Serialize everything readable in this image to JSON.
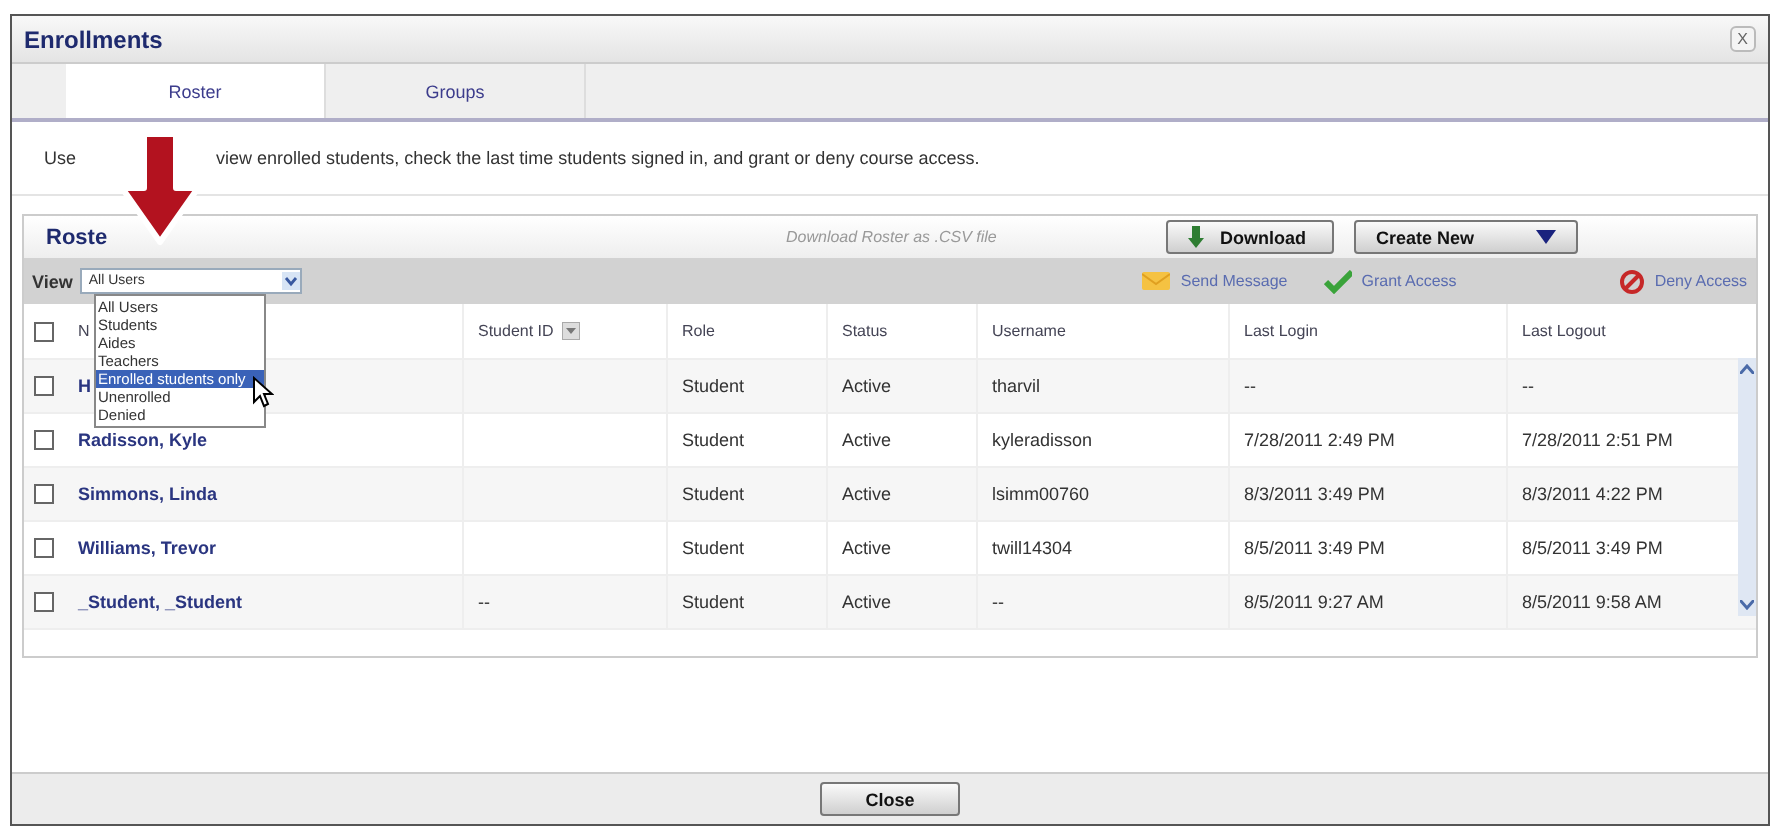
{
  "window": {
    "title": "Enrollments",
    "close": "X"
  },
  "tabs": [
    {
      "label": "Roster",
      "selected": true
    },
    {
      "label": "Groups",
      "selected": false
    }
  ],
  "instructions": [
    "Use",
    "view enrolled students, check the last time students signed in, and grant or deny course access."
  ],
  "panel": {
    "title": "Roste",
    "download_hint": "Download  Roster  as  .CSV file",
    "download_button": "Download",
    "create_button": "Create New"
  },
  "toolbar": {
    "view_label": "View",
    "view_value": "All Users",
    "actions": [
      {
        "label": "Send Message",
        "kind": "message"
      },
      {
        "label": "Grant Access",
        "kind": "grant"
      },
      {
        "label": "Deny Access",
        "kind": "deny"
      }
    ]
  },
  "dropdown": [
    {
      "label": "All Users",
      "selected": false
    },
    {
      "label": "Students",
      "selected": false
    },
    {
      "label": "Aides",
      "selected": false
    },
    {
      "label": "Teachers",
      "selected": false
    },
    {
      "label": "Enrolled students only",
      "selected": true
    },
    {
      "label": "Unenrolled",
      "selected": false
    },
    {
      "label": "Denied",
      "selected": false
    }
  ],
  "table": {
    "select_all_checked": false,
    "columns": [
      "N",
      "Student ID",
      "Role",
      "Status",
      "Username",
      "Last Login",
      "Last Logout"
    ],
    "rows": [
      {
        "checked": false,
        "cells": [
          "H",
          "",
          "Student",
          "Active",
          "tharvil",
          "--",
          "--"
        ]
      },
      {
        "checked": false,
        "cells": [
          "Radisson, Kyle",
          "",
          "Student",
          "Active",
          "kyleradisson",
          "7/28/2011 2:49 PM",
          "7/28/2011 2:51 PM"
        ]
      },
      {
        "checked": false,
        "cells": [
          "Simmons, Linda",
          "",
          "Student",
          "Active",
          "lsimm00760",
          "8/3/2011 3:49 PM",
          "8/3/2011 4:22 PM"
        ]
      },
      {
        "checked": false,
        "cells": [
          "Williams, Trevor",
          "",
          "Student",
          "Active",
          "twill14304",
          "8/5/2011 3:49 PM",
          "8/5/2011 3:49 PM"
        ]
      },
      {
        "checked": false,
        "cells": [
          "_Student, _Student",
          "--",
          "Student",
          "Active",
          "--",
          "8/5/2011 9:27 AM",
          "8/5/2011 9:58 AM"
        ]
      }
    ]
  },
  "footer": {
    "close_button": "Close"
  }
}
